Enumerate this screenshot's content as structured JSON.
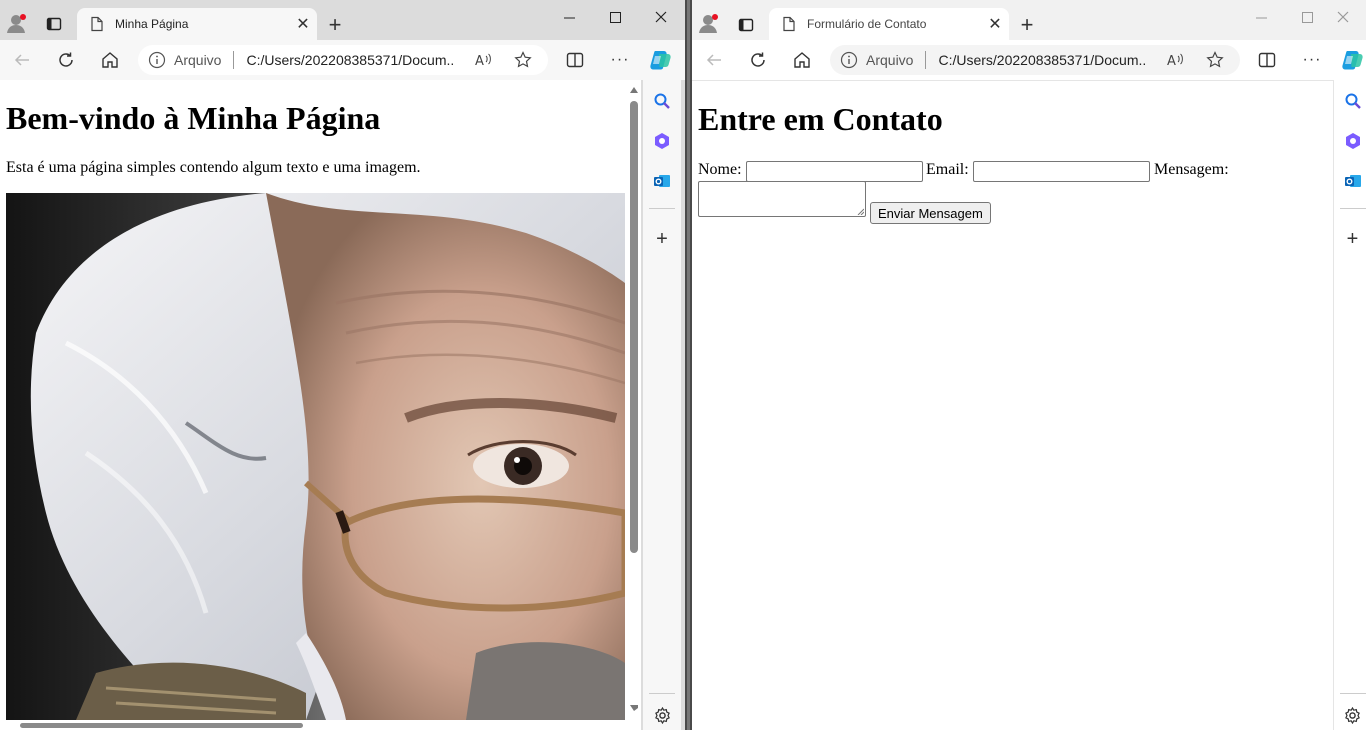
{
  "left_window": {
    "tab": {
      "title": "Minha Página"
    },
    "address": {
      "scheme": "Arquivo",
      "url": "C:/Users/202208385371/Docum..."
    },
    "page": {
      "heading": "Bem-vindo à Minha Página",
      "paragraph": "Esta é uma página simples contendo algum texto e uma imagem."
    },
    "icons": {
      "profile": "profile-icon",
      "tab_actions": "tab-actions-icon",
      "new_tab": "plus-icon",
      "back": "back-arrow-icon",
      "refresh": "refresh-icon",
      "home": "home-icon",
      "read_aloud": "read-aloud-icon",
      "favorite": "star-icon",
      "split_screen": "split-screen-icon",
      "more": "more-icon",
      "copilot": "copilot-icon"
    }
  },
  "right_window": {
    "tab": {
      "title": "Formulário de Contato"
    },
    "address": {
      "scheme": "Arquivo",
      "url": "C:/Users/202208385371/Docum..."
    },
    "page": {
      "heading": "Entre em Contato",
      "name_label": "Nome:",
      "email_label": "Email:",
      "message_label": "Mensagem:",
      "submit_label": "Enviar Mensagem"
    }
  },
  "sidebar": {
    "items": [
      "search-icon",
      "copilot-apps-icon",
      "outlook-icon",
      "add-icon",
      "settings-icon"
    ]
  },
  "colors": {
    "accent_blue": "#0078d4",
    "notification_red": "#e81123"
  }
}
